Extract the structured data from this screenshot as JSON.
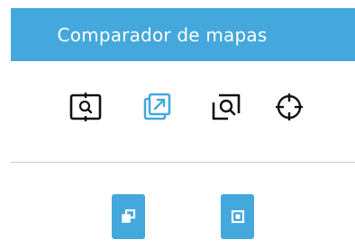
{
  "header": {
    "title": "Comparador de mapas",
    "background_color": "#44a8dd",
    "text_color": "#ffffff"
  },
  "tools": [
    {
      "icon": "map-search-frame-icon",
      "active": false,
      "color": "#111111"
    },
    {
      "icon": "open-external-icon",
      "active": true,
      "color": "#44a8dd"
    },
    {
      "icon": "zoom-area-icon",
      "active": false,
      "color": "#111111"
    },
    {
      "icon": "crosshair-icon",
      "active": false,
      "color": "#111111"
    }
  ],
  "actions": [
    {
      "icon": "overlay-windows-icon",
      "color": "#44a8dd"
    },
    {
      "icon": "close-square-icon",
      "color": "#44a8dd"
    }
  ],
  "colors": {
    "accent": "#44a8dd",
    "divider": "#cfcfcf",
    "icon_default": "#111111"
  }
}
